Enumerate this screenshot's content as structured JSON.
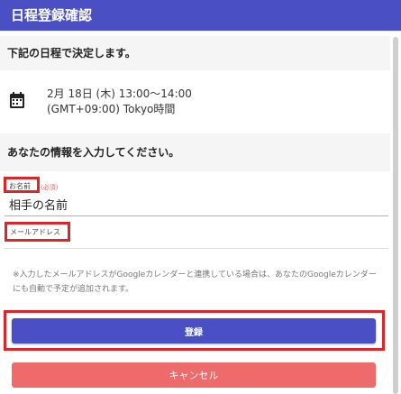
{
  "dialog": {
    "title": "日程登録確認"
  },
  "confirm_text": "下記の日程で決定します。",
  "schedule": {
    "icon": "calendar-icon",
    "datetime": "2月 18日 (木) 13:00〜14:00",
    "timezone": "(GMT+09:00) Tokyo時間"
  },
  "input_prompt": "あなたの情報を入力してください。",
  "form": {
    "name_label": "お名前",
    "required_badge": "(必須)",
    "name_value": "相手の名前",
    "email_label": "メールアドレス",
    "note": "※入力したメールアドレスがGoogleカレンダーと連携している場合は、あなたのGoogleカレンダーにも自動で予定が追加されます。"
  },
  "buttons": {
    "submit": "登録",
    "cancel": "キャンセル"
  },
  "colors": {
    "accent": "#4a50c4",
    "cancel": "#ee6b6b",
    "highlight": "#d8262b",
    "valid_underline": "#7fcf94"
  }
}
